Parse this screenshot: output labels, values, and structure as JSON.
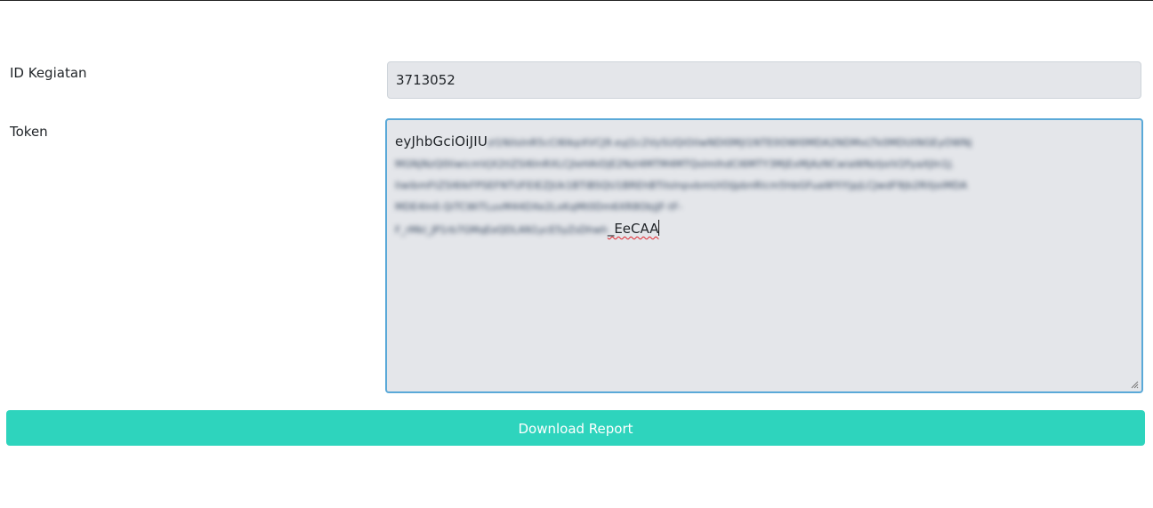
{
  "form": {
    "id_kegiatan": {
      "label": "ID Kegiatan",
      "value": "3713052"
    },
    "token": {
      "label": "Token",
      "visible_start": "eyJhbGciOiJIU",
      "blurred_lines": [
        "zI1NiIsInR5cCI6IkpXVCJ9.eyJ1c2VySUQiOiIwNDI0MjI1NTE0OWI0MDA2NDMxLTk0MDUtNGEyOWNj",
        "MGNjNzQ0IiwicmVjX2tlZSI6InRXLCJleHAiOjE2NzI4MTM4MTQsImlhdCI6MTY3MjExMjAzNCwiaWNzIjoiV2FyaXJIn1J.",
        "IiwibmFtZSI6IkFPSEFNTUFEIEZJUk1BTiBSQU1BREhBTiIsInpvbmUiOiJpbnRlcm5hbGFuaWYiYjpjLCJwdF9jb2RlIjoiMDA",
        "MDE4In0.QiTCWiTLuvM44DXe2LxKqMt0Dm6XR8ObjJF-tF-"
      ],
      "tail_blurred": "F_rMkl_JP1rb7GMqEeQDLAN1ycE5yZsDhwh",
      "visible_end": "_EeCAA"
    }
  },
  "actions": {
    "download_label": "Download Report"
  },
  "colors": {
    "input_bg": "#e4e6ea",
    "focus_border": "#5aa9d8",
    "button_bg": "#2ed4bd",
    "button_text": "#ffffff",
    "spellcheck": "#e0242c"
  },
  "icons": {
    "resize_grip": "resize-grip-icon"
  }
}
